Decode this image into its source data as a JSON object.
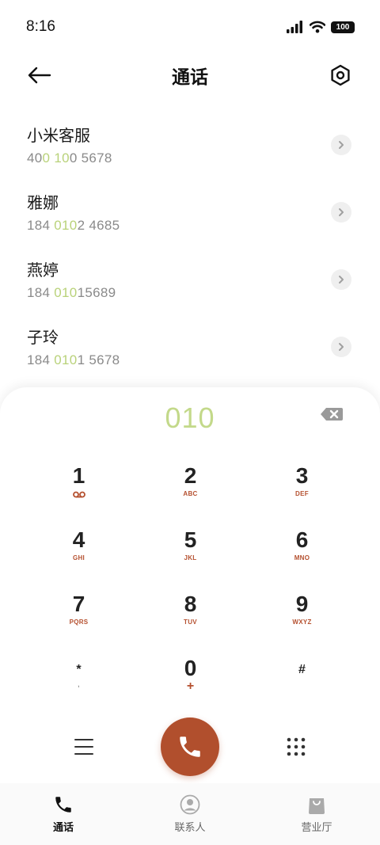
{
  "status": {
    "time": "8:16",
    "battery": "100"
  },
  "header": {
    "title": "通话",
    "back_icon": "back-arrow-icon",
    "settings_icon": "settings-hexagon-icon"
  },
  "results": [
    {
      "name": "小米客服",
      "num": [
        "40",
        "0",
        " ",
        "10",
        "0 5678"
      ]
    },
    {
      "name": "雅娜",
      "num": [
        "184 ",
        "010",
        "",
        "",
        "2 4685"
      ]
    },
    {
      "name": "燕婷",
      "num": [
        "184 ",
        "010",
        "",
        "",
        "15689"
      ]
    },
    {
      "name": "子玲",
      "num": [
        "184 ",
        "010",
        "",
        "",
        "1 5678"
      ]
    }
  ],
  "dial": {
    "input": "010"
  },
  "keys": [
    {
      "digit": "1",
      "letters": ""
    },
    {
      "digit": "2",
      "letters": "ABC"
    },
    {
      "digit": "3",
      "letters": "DEF"
    },
    {
      "digit": "4",
      "letters": "GHI"
    },
    {
      "digit": "5",
      "letters": "JKL"
    },
    {
      "digit": "6",
      "letters": "MNO"
    },
    {
      "digit": "7",
      "letters": "PQRS"
    },
    {
      "digit": "8",
      "letters": "TUV"
    },
    {
      "digit": "9",
      "letters": "WXYZ"
    },
    {
      "digit": "*",
      "letters": ","
    },
    {
      "digit": "0",
      "letters": "+"
    },
    {
      "digit": "#",
      "letters": ""
    }
  ],
  "nav": [
    {
      "label": "通话",
      "icon": "phone-icon",
      "active": true
    },
    {
      "label": "联系人",
      "icon": "contacts-icon",
      "active": false
    },
    {
      "label": "营业厅",
      "icon": "shopping-bag-icon",
      "active": false
    }
  ],
  "colors": {
    "accent": "#b14f2d",
    "highlight": "#c3d98a"
  }
}
